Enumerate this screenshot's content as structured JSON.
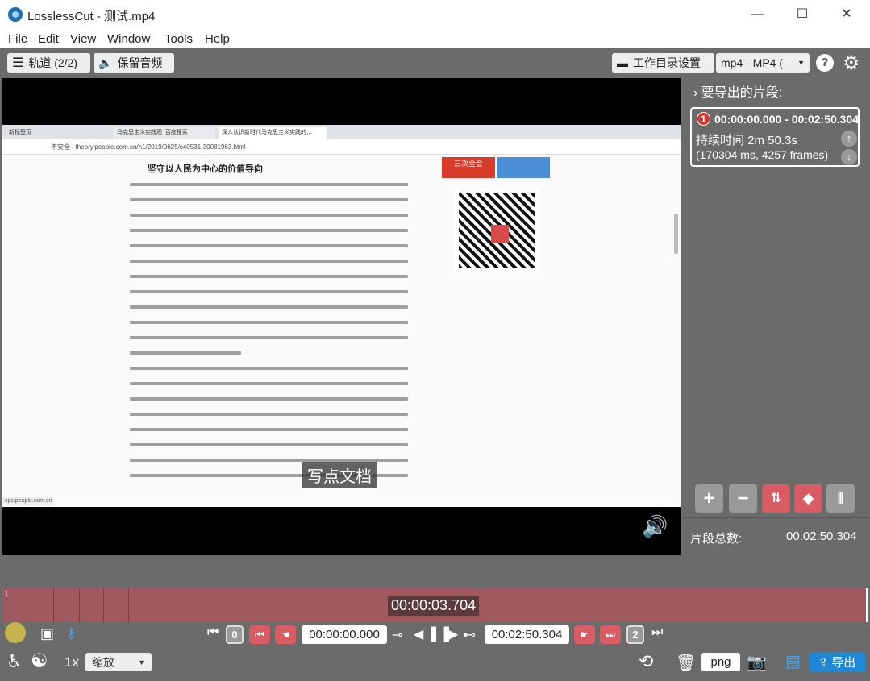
{
  "window": {
    "title": "LosslessCut - 测试.mp4",
    "controls": [
      "—",
      "☐",
      "✕"
    ]
  },
  "menu": [
    "File",
    "Edit",
    "View",
    "Window",
    "Tools",
    "Help"
  ],
  "toolbar": {
    "tracks_label": "轨道 (2/2)",
    "keep_audio_label": "保留音频",
    "workdir_label": "工作目录设置",
    "format_value": "mp4 - MP4 (",
    "help": "?"
  },
  "video": {
    "browser_tabs": [
      "新标签页",
      "马克思主义实践观_百度搜索",
      "深入认识新时代马克思主义实践的…"
    ],
    "browser_url": "不安全 | theory.people.com.cn/n1/2019/0625/c40531-30081963.html",
    "article_heading": "坚守以人民为中心的价值导向",
    "side_button": "三次全会",
    "status_url": "cpc.people.com.cn",
    "subtitle": "写点文档"
  },
  "segments_panel": {
    "header": "要导出的片段:",
    "segment": {
      "index": "1",
      "range": "00:00:00.000 - 00:02:50.304",
      "duration": "持续时间 2m 50.3s",
      "detail": "(170304 ms, 4257 frames)"
    },
    "total_label": "片段总数:",
    "total_value": "00:02:50.304"
  },
  "timeline": {
    "current_time": "00:00:03.704",
    "segment_number": "1"
  },
  "controls": {
    "start_index": "0",
    "start_time": "00:00:00.000",
    "end_time": "00:02:50.304",
    "end_index": "2",
    "speed": "1x",
    "zoom_label": "缩放",
    "snapshot_format": "png",
    "export_label": "导出"
  }
}
